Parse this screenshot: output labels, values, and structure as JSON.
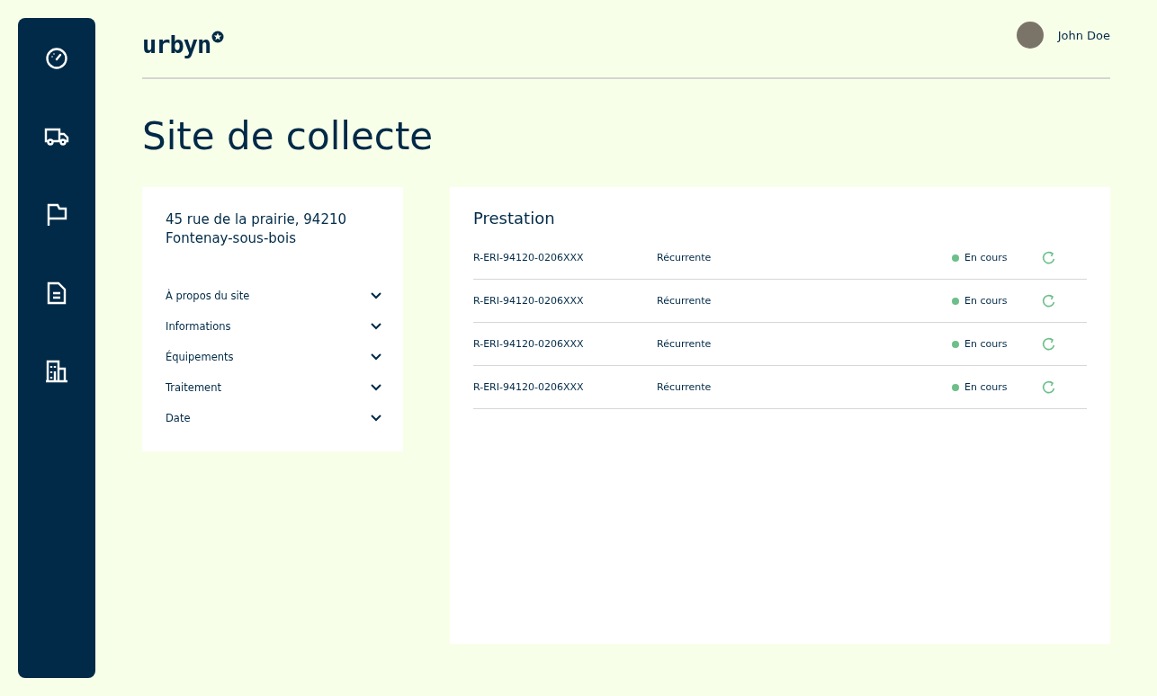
{
  "header": {
    "logo": "urbyn",
    "user": {
      "name": "John Doe"
    }
  },
  "title": "Site de collecte",
  "site": {
    "address_line_1": "45 rue de la prairie, 94210",
    "address_line_2": "Fontenay-sous-bois",
    "sections": [
      {
        "label": "À propos du site",
        "expanded": false
      },
      {
        "label": "Informations",
        "expanded": false
      },
      {
        "label": "Équipements",
        "expanded": false
      },
      {
        "label": "Traitement",
        "expanded": false
      },
      {
        "label": "Date",
        "expanded": false
      }
    ]
  },
  "prestation": {
    "title": "Prestation",
    "rows": [
      {
        "reference": "R-ERI-94120-0206XXX",
        "type": "Récurrente",
        "status": "En cours",
        "color": "#6dbf8a"
      },
      {
        "reference": "R-ERI-94120-0206XXX",
        "type": "Récurrente",
        "status": "En cours",
        "color": "#6dbf8a"
      },
      {
        "reference": "R-ERI-94120-0206XXX",
        "type": "Récurrente",
        "status": "En cours",
        "color": "#6dbf8a"
      },
      {
        "reference": "R-ERI-94120-0206XXX",
        "type": "Récurrente",
        "status": "En cours",
        "color": "#6dbf8a"
      }
    ]
  }
}
